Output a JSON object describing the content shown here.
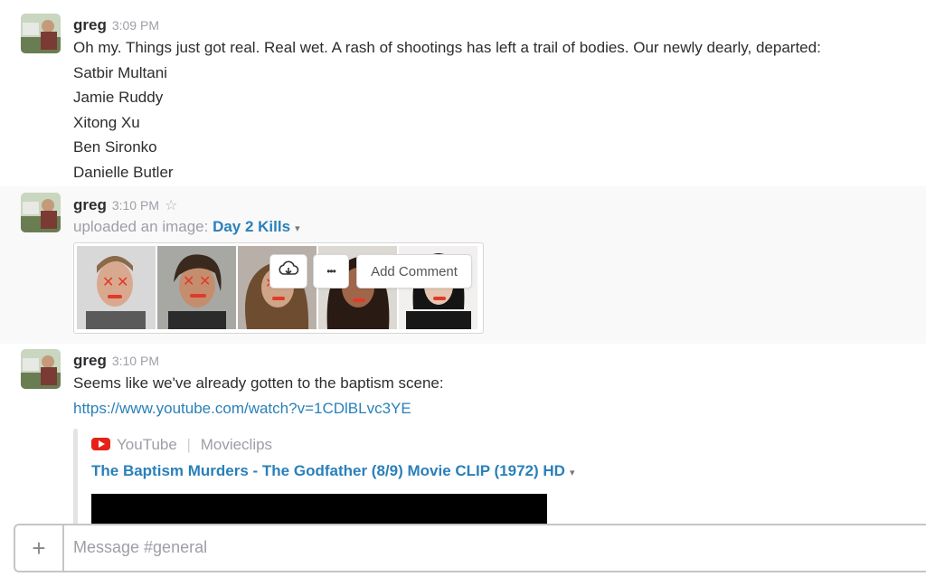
{
  "messages": [
    {
      "author": "greg",
      "time": "3:09 PM",
      "lines": [
        "Oh my.  Things just got real.  Real wet.   A rash of shootings has left a trail of bodies.  Our newly dearly, departed:",
        "Satbir Multani",
        "Jamie Ruddy",
        "Xitong Xu",
        "Ben Sironko",
        "Danielle Butler"
      ]
    },
    {
      "author": "greg",
      "time": "3:10 PM",
      "star_icon": "☆",
      "upload_prefix": "uploaded an image: ",
      "image_title": "Day 2 Kills",
      "caret": "▾",
      "actions": {
        "download_icon": "download-icon",
        "more_label": "•••",
        "comment_label": "Add Comment"
      }
    },
    {
      "author": "greg",
      "time": "3:10 PM",
      "text": "Seems like we've already gotten to the baptism scene:",
      "url": "https://www.youtube.com/watch?v=1CDlBLvc3YE",
      "attachment": {
        "service": "YouTube",
        "separator": "|",
        "channel": "Movieclips",
        "title": "The Baptism Murders - The Godfather (8/9) Movie CLIP (1972) HD",
        "caret": "▾"
      }
    }
  ],
  "composer": {
    "plus_label": "+",
    "placeholder": "Message #general"
  },
  "colors": {
    "link": "#2a80b9",
    "youtube_red": "#e62117",
    "muted": "#9e9ea6"
  }
}
